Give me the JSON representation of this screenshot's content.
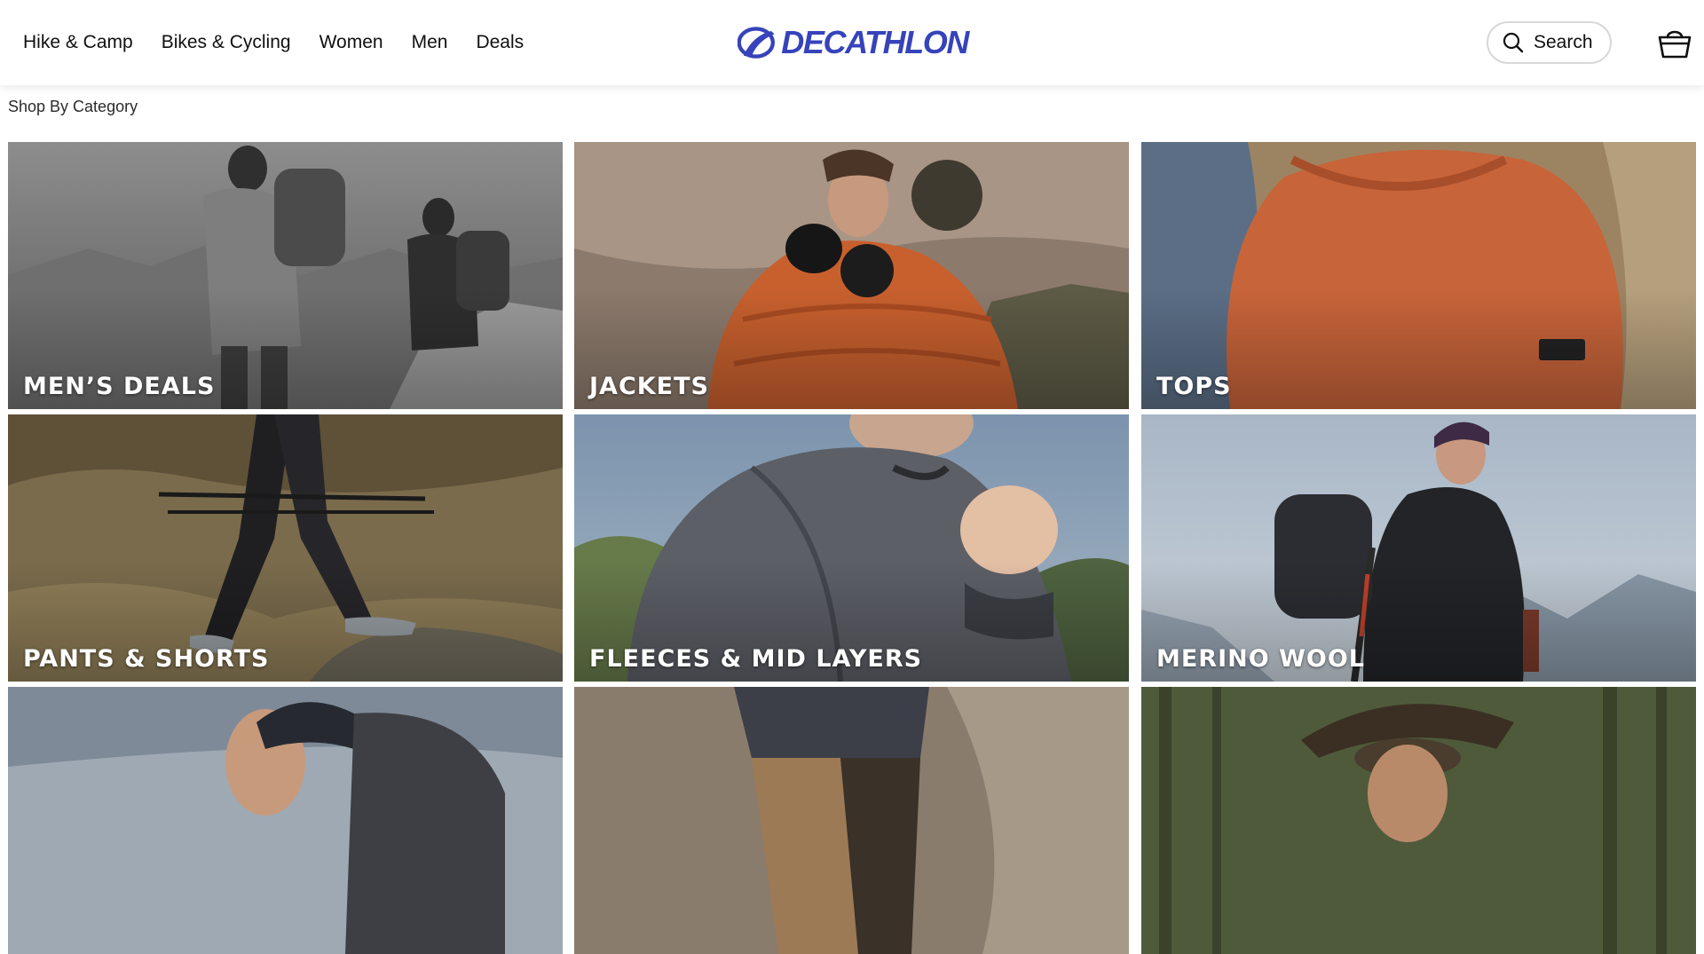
{
  "header": {
    "nav": [
      "Hike & Camp",
      "Bikes & Cycling",
      "Women",
      "Men",
      "Deals"
    ],
    "logo_text": "DECATHLON",
    "search_label": "Search",
    "brand_color": "#3643ba",
    "icons": {
      "search": "search-icon",
      "cart": "basket-icon"
    }
  },
  "section": {
    "title": "Shop By Category"
  },
  "categories": [
    {
      "label": "MEN’S DEALS"
    },
    {
      "label": "JACKETS"
    },
    {
      "label": "TOPS"
    },
    {
      "label": "PANTS & SHORTS"
    },
    {
      "label": "FLEECES & MID LAYERS"
    },
    {
      "label": "MERINO WOOL"
    },
    {
      "label": ""
    },
    {
      "label": ""
    },
    {
      "label": ""
    }
  ]
}
